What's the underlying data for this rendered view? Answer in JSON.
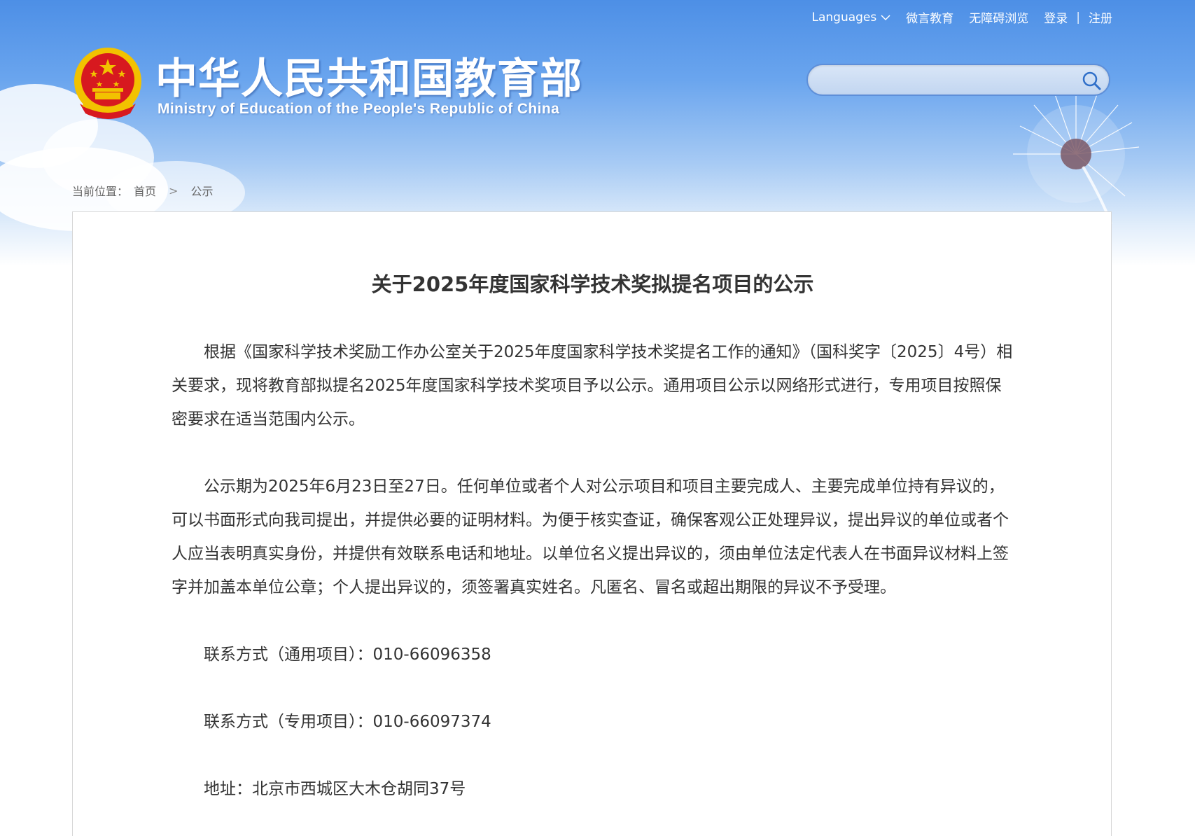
{
  "topnav": {
    "languages": "Languages",
    "wechat_edu": "微言教育",
    "accessibility": "无障碍浏览",
    "login": "登录",
    "separator": "|",
    "register": "注册"
  },
  "site": {
    "title_cn": "中华人民共和国教育部",
    "title_en": "Ministry of Education of the People's Republic of China"
  },
  "search": {
    "value": "",
    "placeholder": ""
  },
  "breadcrumb": {
    "prefix": "当前位置：",
    "home": "首页",
    "separator": ">",
    "current": "公示"
  },
  "article": {
    "title": "关于2025年度国家科学技术奖拟提名项目的公示",
    "paragraphs": [
      "根据《国家科学技术奖励工作办公室关于2025年度国家科学技术奖提名工作的通知》（国科奖字〔2025〕4号）相关要求，现将教育部拟提名2025年度国家科学技术奖项目予以公示。通用项目公示以网络形式进行，专用项目按照保密要求在适当范围内公示。",
      "公示期为2025年6月23日至27日。任何单位或者个人对公示项目和项目主要完成人、主要完成单位持有异议的，可以书面形式向我司提出，并提供必要的证明材料。为便于核实查证，确保客观公正处理异议，提出异议的单位或者个人应当表明真实身份，并提供有效联系电话和地址。以单位名义提出异议的，须由单位法定代表人在书面异议材料上签字并加盖本单位公章；个人提出异议的，须签署真实姓名。凡匿名、冒名或超出期限的异议不予受理。",
      "联系方式（通用项目）：010-66096358",
      "联系方式（专用项目）：010-66097374",
      "地址：北京市西城区大木仓胡同37号"
    ]
  },
  "colors": {
    "header_blue": "#4d8fe6",
    "title_text": "#333333",
    "breadcrumb_text": "#666666",
    "emblem_red": "#d7191f",
    "emblem_gold": "#f2c200"
  }
}
